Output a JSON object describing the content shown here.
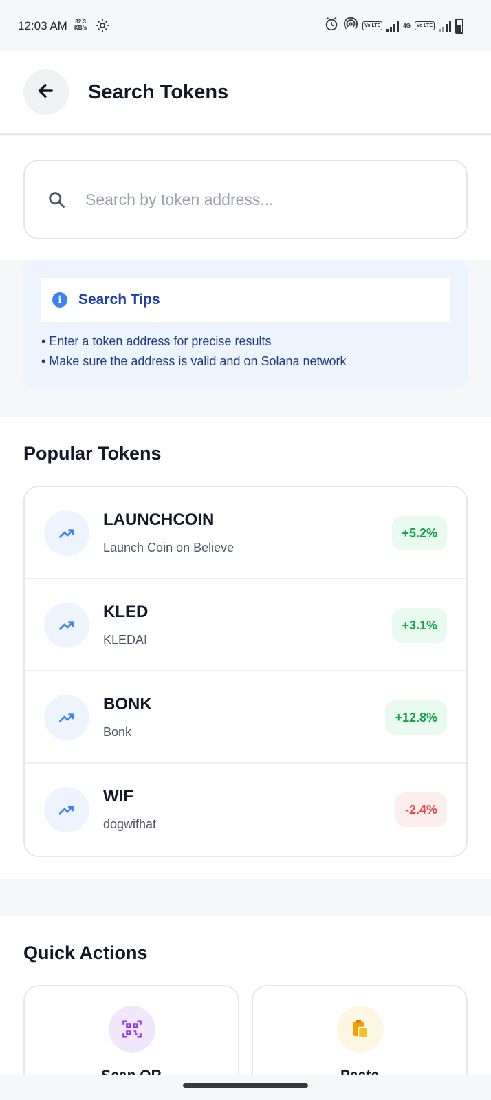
{
  "status_bar": {
    "time": "12:03 AM",
    "speed_value": "82.3",
    "speed_unit": "KB/s",
    "volte1": "Vo LTE",
    "network": "4G",
    "volte2": "Vo LTE",
    "icons": [
      "gear-icon",
      "alarm-icon",
      "hotspot-icon",
      "signal-icon",
      "battery-icon"
    ]
  },
  "header": {
    "title": "Search Tokens",
    "back_icon": "arrow-left-icon"
  },
  "search": {
    "placeholder": "Search by token address...",
    "value": "",
    "icon": "search-icon"
  },
  "tips": {
    "title": "Search Tips",
    "items": [
      "• Enter a token address for precise results",
      "• Make sure the address is valid and on Solana network"
    ]
  },
  "popular": {
    "title": "Popular Tokens",
    "tokens": [
      {
        "symbol": "LAUNCHCOIN",
        "name": "Launch Coin on Believe",
        "change": "+5.2%",
        "direction": "up"
      },
      {
        "symbol": "KLED",
        "name": "KLEDAI",
        "change": "+3.1%",
        "direction": "up"
      },
      {
        "symbol": "BONK",
        "name": "Bonk",
        "change": "+12.8%",
        "direction": "up"
      },
      {
        "symbol": "WIF",
        "name": "dogwifhat",
        "change": "-2.4%",
        "direction": "down"
      }
    ]
  },
  "quick_actions": {
    "title": "Quick Actions",
    "actions": [
      {
        "label": "Scan QR",
        "icon": "qr-code-icon"
      },
      {
        "label": "Paste",
        "icon": "clipboard-icon"
      }
    ]
  },
  "colors": {
    "accent": "#3b82f6",
    "positive": "#16a34a",
    "negative": "#ef4444",
    "tips_bg": "#eef4fe"
  }
}
